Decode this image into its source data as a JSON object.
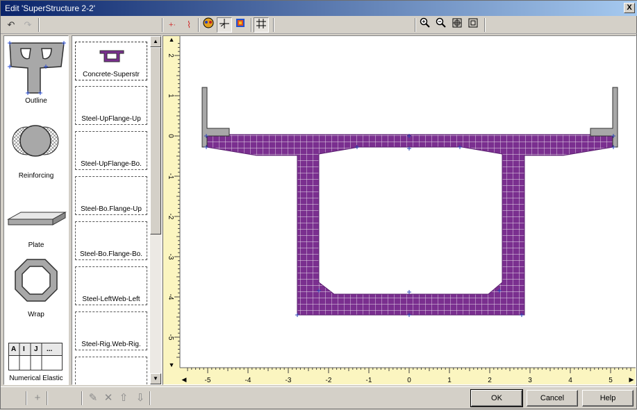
{
  "window": {
    "title": "Edit 'SuperStructure 2-2'",
    "close_glyph": "X"
  },
  "toolbar": {
    "undo_icon": "undo-icon",
    "redo_icon": "redo-icon",
    "tools": [
      "add-point-icon",
      "polyline-icon",
      "color-view-icon",
      "move-axis-icon",
      "layer-icon",
      "grid-icon",
      "zoom-in-icon",
      "zoom-out-icon",
      "zoom-fit-icon",
      "zoom-window-icon"
    ]
  },
  "shapes": [
    {
      "label": "Outline",
      "icon": "outline-shape-icon"
    },
    {
      "label": "Reinforcing",
      "icon": "reinforcing-shape-icon"
    },
    {
      "label": "Plate",
      "icon": "plate-shape-icon"
    },
    {
      "label": "Wrap",
      "icon": "wrap-shape-icon"
    },
    {
      "label": "Numerical Elastic",
      "icon": "numerical-elastic-icon",
      "table_headers": [
        "A",
        "I",
        "J",
        "..."
      ]
    }
  ],
  "components": [
    "Concrete-Superstr",
    "Steel-UpFlange-Up",
    "Steel-UpFlange-Bo.",
    "Steel-Bo.Flange-Up",
    "Steel-Bo.Flange-Bo.",
    "Steel-LeftWeb-Left",
    "Steel-Rig.Web-Rig.",
    ""
  ],
  "ruler": {
    "x_ticks": [
      "-5",
      "-4",
      "-3",
      "-2",
      "-1",
      "0",
      "1",
      "2",
      "3",
      "4",
      "5"
    ],
    "y_ticks": [
      "2",
      "1",
      "0",
      "-1",
      "-2",
      "-3",
      "-4",
      "-5"
    ]
  },
  "section": {
    "fill": "#7a2f8f",
    "barrier_fill": "#a8a8a8",
    "point_color": "#2a3fb0"
  },
  "buttons": {
    "ok": "OK",
    "cancel": "Cancel",
    "help": "Help"
  }
}
